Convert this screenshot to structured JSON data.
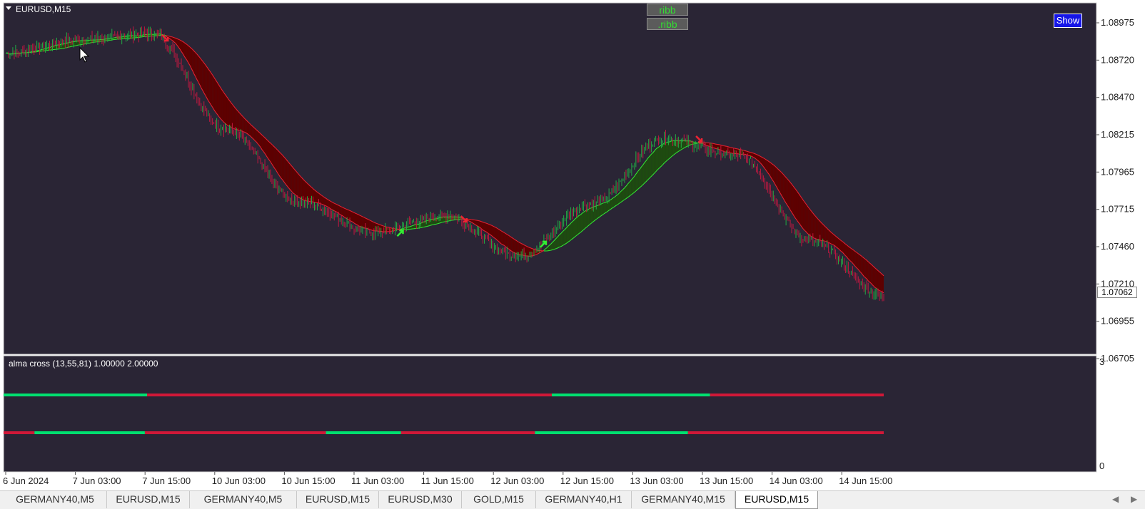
{
  "window": {
    "symbol_title": "EURUSD,M15"
  },
  "colors": {
    "background": "#2a2535",
    "bull_ribbon": "#1e4b10",
    "bear_ribbon": "#5e0000",
    "bull_line": "#33ee33",
    "bear_line": "#ee2233",
    "candle_up": "#22aa44",
    "candle_down": "#c01840",
    "signal_green": "#00e070",
    "signal_red": "#d01838",
    "arrow_orange": "#ff9900"
  },
  "buttons": {
    "ribb_1": "ribb",
    "ribb_2": ".ribb",
    "show": "Show"
  },
  "price_axis": {
    "labels": [
      "1.08975",
      "1.08720",
      "1.08470",
      "1.08215",
      "1.07965",
      "1.07715",
      "1.07460",
      "1.07210",
      "1.06955",
      "1.06705"
    ],
    "current_price": "1.07062"
  },
  "indicator": {
    "title": "alma cross (13,55,81) 1.00000 2.00000",
    "scale_max": "3",
    "scale_min": "0",
    "line1": [
      {
        "from": 0,
        "to": 195,
        "state": "green"
      },
      {
        "from": 195,
        "to": 745,
        "state": "red"
      },
      {
        "from": 745,
        "to": 960,
        "state": "green"
      },
      {
        "from": 960,
        "to": 1196,
        "state": "red"
      }
    ],
    "line2": [
      {
        "from": 0,
        "to": 42,
        "state": "red"
      },
      {
        "from": 42,
        "to": 192,
        "state": "green"
      },
      {
        "from": 192,
        "to": 438,
        "state": "red"
      },
      {
        "from": 438,
        "to": 540,
        "state": "green"
      },
      {
        "from": 540,
        "to": 722,
        "state": "red"
      },
      {
        "from": 722,
        "to": 930,
        "state": "green"
      },
      {
        "from": 930,
        "to": 1196,
        "state": "red"
      }
    ]
  },
  "time_axis": {
    "labels": [
      "6 Jun 2024",
      "7 Jun 03:00",
      "7 Jun 15:00",
      "10 Jun 03:00",
      "10 Jun 15:00",
      "11 Jun 03:00",
      "11 Jun 15:00",
      "12 Jun 03:00",
      "12 Jun 15:00",
      "13 Jun 03:00",
      "13 Jun 15:00",
      "14 Jun 03:00",
      "14 Jun 15:00"
    ]
  },
  "tabs": [
    {
      "label": "GERMANY40,M5",
      "active": false
    },
    {
      "label": "EURUSD,M15",
      "active": false
    },
    {
      "label": "GERMANY40,M5",
      "active": false
    },
    {
      "label": "EURUSD,M15",
      "active": false
    },
    {
      "label": "EURUSD,M30",
      "active": false
    },
    {
      "label": "GOLD,M15",
      "active": false
    },
    {
      "label": "GERMANY40,H1",
      "active": false
    },
    {
      "label": "GERMANY40,M15",
      "active": false
    },
    {
      "label": "EURUSD,M15",
      "active": true
    }
  ],
  "chart_data": {
    "type": "line",
    "symbol": "EURUSD",
    "timeframe": "M15",
    "x": [
      "6 Jun 2024",
      "7 Jun 03:00",
      "7 Jun 15:00",
      "10 Jun 03:00",
      "10 Jun 15:00",
      "11 Jun 03:00",
      "11 Jun 15:00",
      "12 Jun 03:00",
      "12 Jun 15:00",
      "13 Jun 03:00",
      "13 Jun 15:00",
      "14 Jun 03:00",
      "14 Jun 15:00"
    ],
    "ylim": [
      1.06705,
      1.08975
    ],
    "series": [
      {
        "values": [
          1.0877,
          1.0886,
          1.089,
          1.0826,
          1.0777,
          1.0756,
          1.0767,
          1.074,
          1.0775,
          1.0819,
          1.0808,
          1.075,
          1.0713
        ]
      }
    ],
    "current_price": 1.07062
  }
}
